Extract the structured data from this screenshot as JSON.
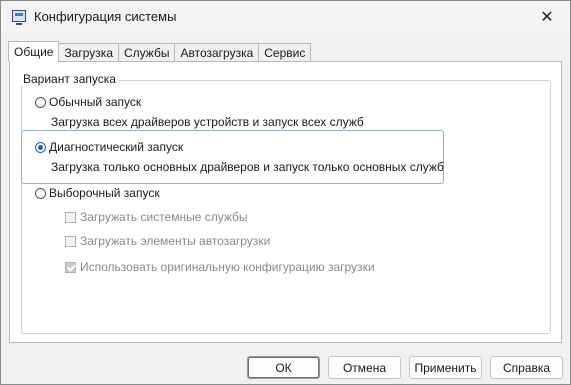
{
  "window": {
    "title": "Конфигурация системы",
    "close_icon": "close-icon"
  },
  "tabs": [
    {
      "label": "Общие",
      "active": true
    },
    {
      "label": "Загрузка",
      "active": false
    },
    {
      "label": "Службы",
      "active": false
    },
    {
      "label": "Автозагрузка",
      "active": false
    },
    {
      "label": "Сервис",
      "active": false
    }
  ],
  "startup": {
    "group_label": "Вариант запуска",
    "normal": {
      "label": "Обычный запуск",
      "description": "Загрузка всех драйверов устройств и запуск всех служб",
      "checked": false
    },
    "diagnostic": {
      "label": "Диагностический запуск",
      "description": "Загрузка только основных драйверов и запуск только основных служб",
      "checked": true
    },
    "selective": {
      "label": "Выборочный запуск",
      "checked": false,
      "options": [
        {
          "label": "Загружать системные службы",
          "checked": false
        },
        {
          "label": "Загружать элементы автозагрузки",
          "checked": false
        },
        {
          "label": "Использовать оригинальную конфигурацию загрузки",
          "checked": true
        }
      ]
    }
  },
  "buttons": {
    "ok": "ОК",
    "cancel": "Отмена",
    "apply": "Применить",
    "help": "Справка"
  },
  "colors": {
    "accent": "#1a5fb4",
    "focus": "#8fb1d9"
  }
}
